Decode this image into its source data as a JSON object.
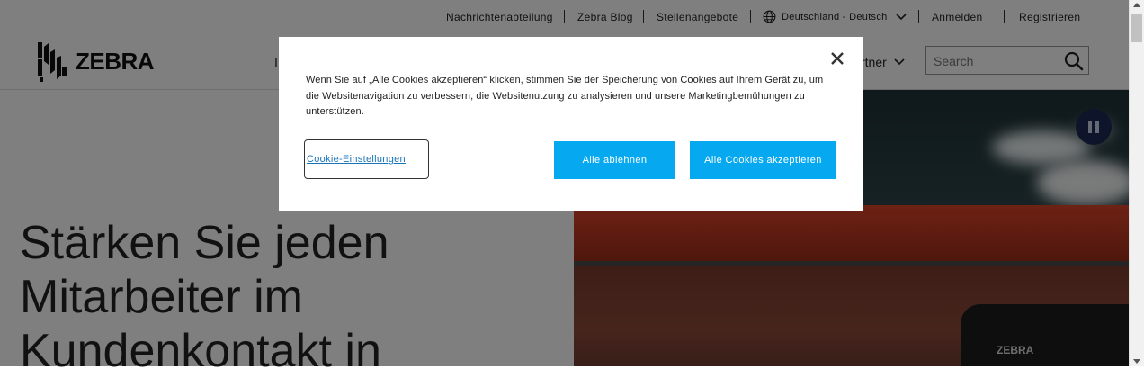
{
  "utility_nav": {
    "newsroom": "Nachrichtenabteilung",
    "blog": "Zebra Blog",
    "jobs": "Stellenangebote",
    "region": "Deutschland - Deutsch",
    "login": "Anmelden",
    "register": "Registrieren"
  },
  "header": {
    "logo_text": "ZEBRA",
    "nav_partial_left": "I",
    "nav_partial_right": "rtner",
    "search_placeholder": "Search"
  },
  "hero": {
    "title_line1": "Stärken Sie jeden",
    "title_line2": "Mitarbeiter im",
    "title_line3": "Kundenkontakt in",
    "device_logo": "ZEBRA"
  },
  "cookie_dialog": {
    "text": "Wenn Sie auf „Alle Cookies akzeptieren“ klicken, stimmen Sie der Speicherung von Cookies auf Ihrem Gerät zu, um die Websitenavigation zu verbessern, die Websitenutzung zu analysieren und unsere Marketingbemühungen zu unterstützen.",
    "settings_label": "Cookie-Einstellungen",
    "reject_label": "Alle ablehnen",
    "accept_label": "Alle Cookies akzeptieren"
  },
  "colors": {
    "accent_button": "#06a8f0",
    "overlay": "rgba(0,0,0,0.5)",
    "pause_button": "#1c2b55"
  },
  "icons": [
    "zebra-logo-icon",
    "globe-icon",
    "chevron-down-icon",
    "search-icon",
    "close-icon",
    "pause-icon"
  ]
}
